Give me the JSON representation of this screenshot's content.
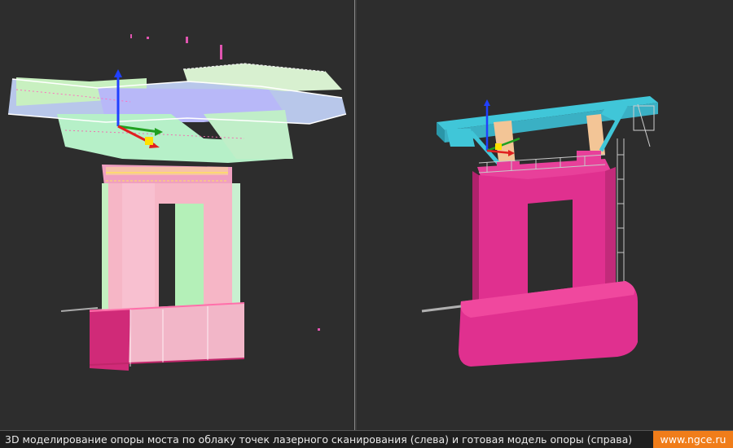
{
  "caption": {
    "text": "3D моделирование опоры моста по облаку точек лазерного сканирования (слева) и готовая модель опоры (справа)",
    "brand": "www.ngce.ru"
  },
  "colors": {
    "background": "#2d2d2d",
    "pier_pink": "#e0308f",
    "pier_light": "#f7b8c9",
    "deck_cyan": "#40c6d8",
    "cloud_green": "#b8f0c0",
    "cloud_lavender": "#c4c4f4",
    "railing": "#c8c8c8",
    "brand_orange": "#f07d1a"
  },
  "icons": {
    "axis_gizmo_left": "xyz-axis-gizmo-icon",
    "axis_gizmo_right": "xyz-axis-gizmo-icon"
  }
}
